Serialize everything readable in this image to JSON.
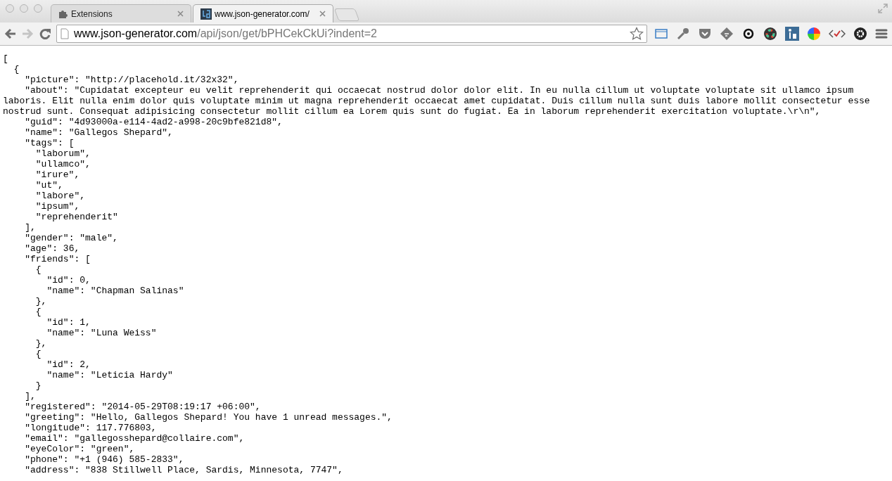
{
  "tabs": [
    {
      "title": "Extensions",
      "kind": "puzzle",
      "selected": false
    },
    {
      "title": "www.json-generator.com/",
      "kind": "logo",
      "selected": true
    }
  ],
  "address_bar": {
    "host": "www.json-generator.com",
    "path": "/api/json/get/bPHCekCkUi?indent=2"
  },
  "content_lines": [
    "[",
    "  {",
    "    \"picture\": \"http://placehold.it/32x32\",",
    "    \"about\": \"Cupidatat excepteur eu velit reprehenderit qui occaecat nostrud dolor dolor elit. In eu nulla cillum ut voluptate voluptate sit ullamco ipsum laboris. Elit nulla enim dolor quis voluptate minim ut magna reprehenderit occaecat amet cupidatat. Duis cillum nulla sunt duis labore mollit consectetur esse nostrud sunt. Consequat adipisicing consectetur mollit cillum ea Lorem quis sunt do fugiat. Ea in laborum reprehenderit exercitation voluptate.\\r\\n\",",
    "    \"guid\": \"4d93000a-e114-4ad2-a998-20c9bfe821d8\",",
    "    \"name\": \"Gallegos Shepard\",",
    "    \"tags\": [",
    "      \"laborum\",",
    "      \"ullamco\",",
    "      \"irure\",",
    "      \"ut\",",
    "      \"labore\",",
    "      \"ipsum\",",
    "      \"reprehenderit\"",
    "    ],",
    "    \"gender\": \"male\",",
    "    \"age\": 36,",
    "    \"friends\": [",
    "      {",
    "        \"id\": 0,",
    "        \"name\": \"Chapman Salinas\"",
    "      },",
    "      {",
    "        \"id\": 1,",
    "        \"name\": \"Luna Weiss\"",
    "      },",
    "      {",
    "        \"id\": 2,",
    "        \"name\": \"Leticia Hardy\"",
    "      }",
    "    ],",
    "    \"registered\": \"2014-05-29T08:19:17 +06:00\",",
    "    \"greeting\": \"Hello, Gallegos Shepard! You have 1 unread messages.\",",
    "    \"longitude\": 117.776803,",
    "    \"email\": \"gallegosshepard@collaire.com\",",
    "    \"eyeColor\": \"green\",",
    "    \"phone\": \"+1 (946) 585-2833\",",
    "    \"address\": \"838 Stillwell Place, Sardis, Minnesota, 7747\","
  ]
}
